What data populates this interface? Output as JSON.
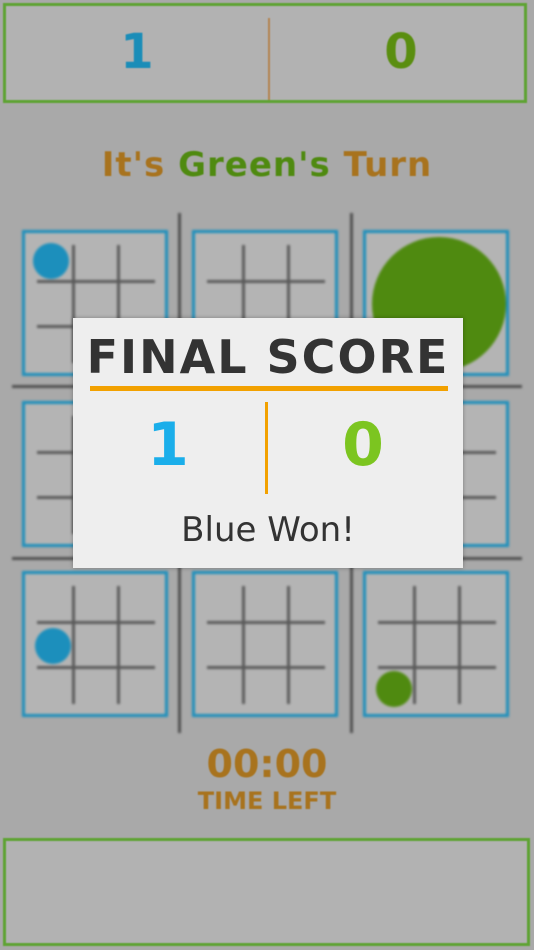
{
  "header": {
    "blue_score": "1",
    "green_score": "0"
  },
  "turn": {
    "prefix": "It's",
    "player": "Green's",
    "suffix": "Turn"
  },
  "board": {
    "colors": {
      "blue": "#1c8fbc",
      "green": "#4f8a10",
      "accent": "#f2a100"
    }
  },
  "timer": {
    "time": "00:00",
    "label": "TIME LEFT"
  },
  "modal": {
    "title": "FINAL SCORE",
    "blue_score": "1",
    "green_score": "0",
    "result": "Blue Won!"
  }
}
